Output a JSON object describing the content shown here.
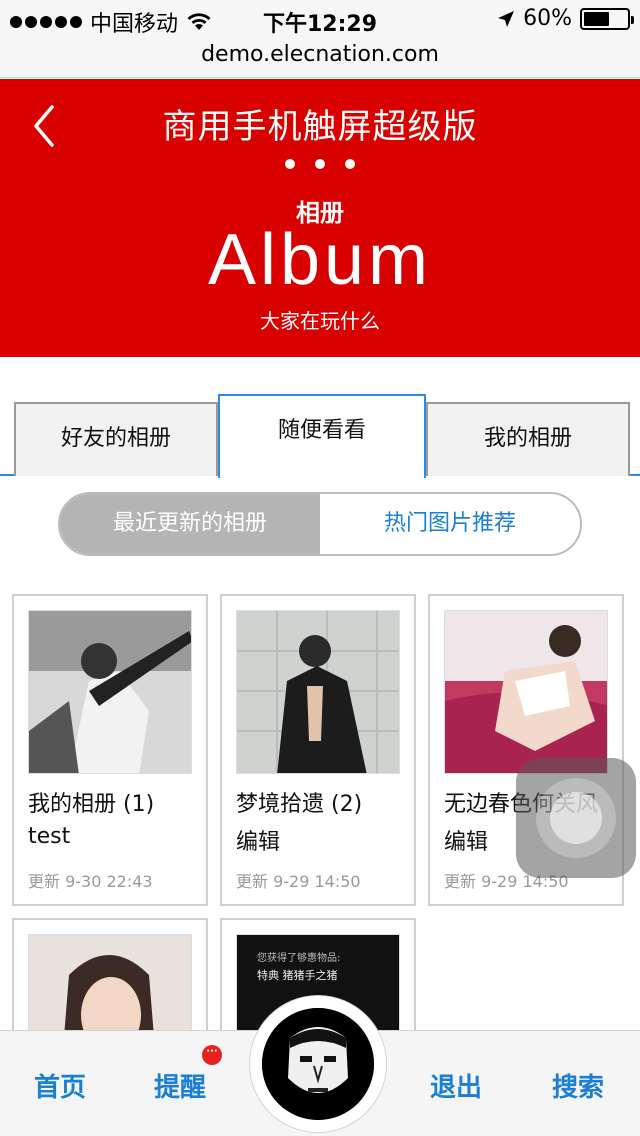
{
  "status_bar": {
    "carrier": "中国移动",
    "time": "下午12:29",
    "battery": "60%",
    "battery_level": 0.6,
    "icons": [
      "signal-dots-icon",
      "wifi-icon",
      "location-arrow-icon",
      "battery-icon"
    ]
  },
  "url": "demo.elecnation.com",
  "header": {
    "title": "商用手机触屏超级版",
    "subtitle": "相册",
    "big_title": "Album",
    "caption": "大家在玩什么",
    "back_icon": "chevron-left-icon",
    "menu_icon": "more-dots-icon"
  },
  "tabs": [
    {
      "label": "好友的相册",
      "active": false
    },
    {
      "label": "随便看看",
      "active": true
    },
    {
      "label": "我的相册",
      "active": false
    }
  ],
  "segment": [
    {
      "label": "最近更新的相册",
      "active": true
    },
    {
      "label": "热门图片推荐",
      "active": false
    }
  ],
  "albums": [
    {
      "name": "我的相册 (1)",
      "sub": "test",
      "date": "更新 9-30 22:43"
    },
    {
      "name": "梦境拾遗 (2)",
      "sub": "编辑",
      "date": "更新 9-29 14:50"
    },
    {
      "name": "无边春色何关风",
      "sub": "编辑",
      "date": "更新 9-29 14:50"
    },
    {
      "name": "",
      "sub": "",
      "date": ""
    },
    {
      "name": "",
      "sub": "",
      "date": ""
    }
  ],
  "album5_thumb_text": [
    "您获得了够惠物品:",
    "特典 猪猪手之猪"
  ],
  "bottom_nav": {
    "home": "首页",
    "remind": "提醒",
    "remind_badge": "···",
    "logout": "退出",
    "search": "搜索"
  },
  "colors": {
    "header_red": "#d90000",
    "accent_blue": "#1a7fd6",
    "tab_border_blue": "#2f8be0"
  }
}
